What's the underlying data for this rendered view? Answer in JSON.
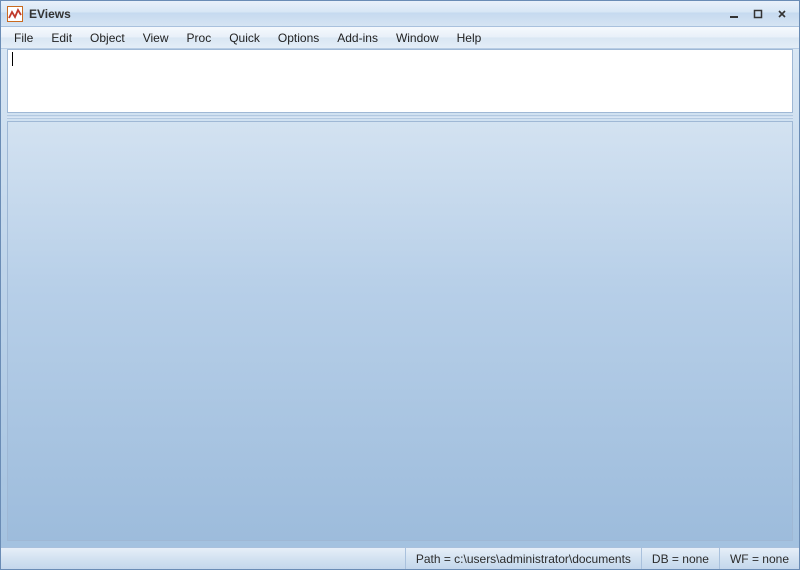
{
  "titlebar": {
    "title": "EViews"
  },
  "menu": {
    "items": [
      "File",
      "Edit",
      "Object",
      "View",
      "Proc",
      "Quick",
      "Options",
      "Add-ins",
      "Window",
      "Help"
    ]
  },
  "command": {
    "value": ""
  },
  "status": {
    "path": "Path = c:\\users\\administrator\\documents",
    "db": "DB = none",
    "wf": "WF = none"
  }
}
